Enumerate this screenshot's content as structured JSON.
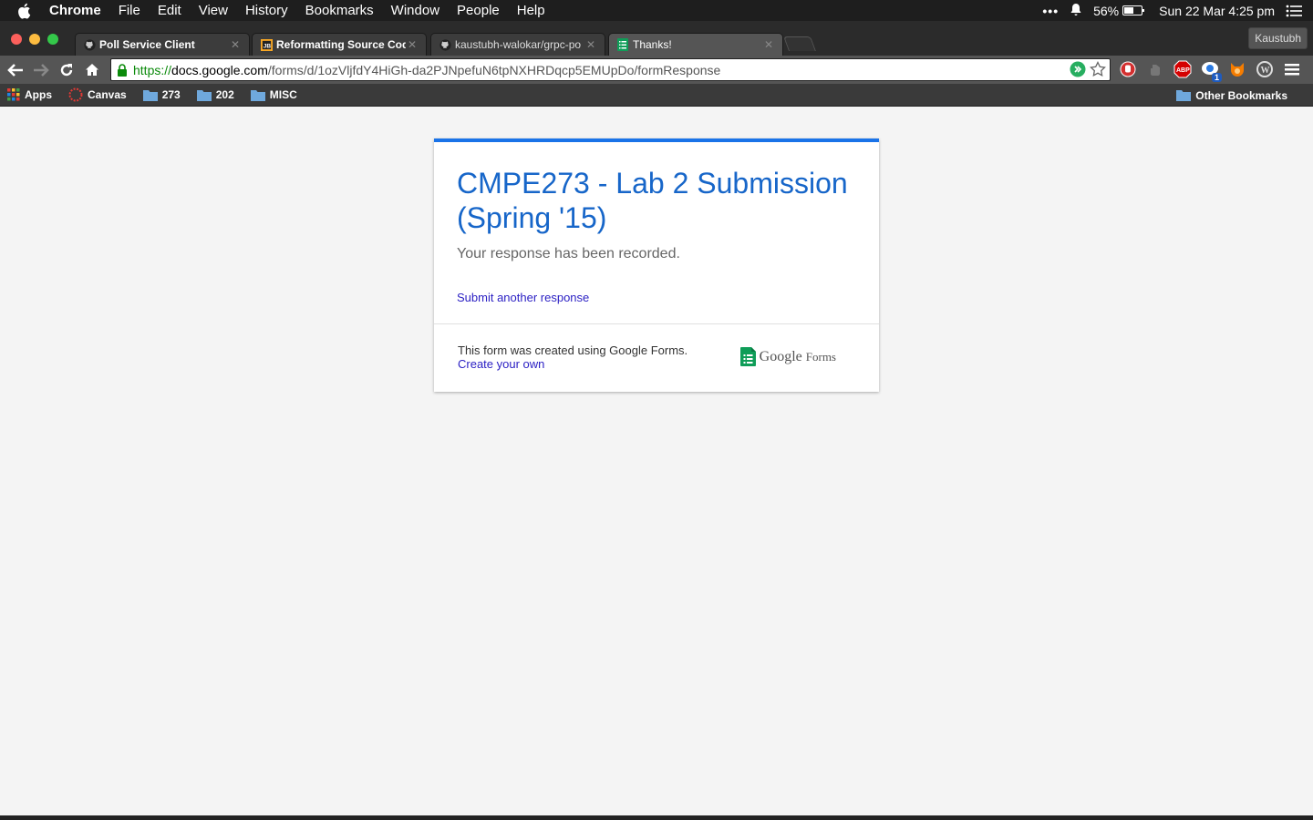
{
  "menubar": {
    "app_name": "Chrome",
    "menus": [
      "File",
      "Edit",
      "View",
      "History",
      "Bookmarks",
      "Window",
      "People",
      "Help"
    ],
    "battery": "56%",
    "battery_level": 0.56,
    "datetime": "Sun 22 Mar  4:25 pm"
  },
  "tabs": [
    {
      "title": "Poll Service Client",
      "icon": "github-icon"
    },
    {
      "title": "Reformatting Source Code",
      "icon": "jetbrains-icon"
    },
    {
      "title": "kaustubh-walokar/grpc-po",
      "icon": "github-icon"
    },
    {
      "title": "Thanks!",
      "icon": "google-forms-icon",
      "active": true
    }
  ],
  "profile": "Kaustubh",
  "omnibox": {
    "scheme": "https://",
    "host": "docs.google.com",
    "path": "/forms/d/1ozVljfdY4HiGh-da2PJNpefuN6tpNXHRDqcp5EMUpDo/formResponse"
  },
  "extensions": {
    "badge_count": "1",
    "abp_label": "ABP"
  },
  "bookmarks": {
    "items": [
      {
        "label": "Apps",
        "icon": "apps-grid-icon"
      },
      {
        "label": "Canvas",
        "icon": "canvas-icon"
      },
      {
        "label": "273",
        "icon": "folder-icon"
      },
      {
        "label": "202",
        "icon": "folder-icon"
      },
      {
        "label": "MISC",
        "icon": "folder-icon"
      }
    ],
    "other": "Other Bookmarks"
  },
  "form": {
    "title": "CMPE273 - Lab 2 Submission (Spring '15)",
    "confirmation": "Your response has been recorded.",
    "submit_another": "Submit another response",
    "footer_text": "This form was created using Google Forms.",
    "create_own": "Create your own",
    "logo_google": "Google",
    "logo_forms": "Forms"
  },
  "colors": {
    "accent": "#1a73e8",
    "title": "#1766c9",
    "link": "#2c21c4",
    "forms_green": "#0f9d58"
  }
}
